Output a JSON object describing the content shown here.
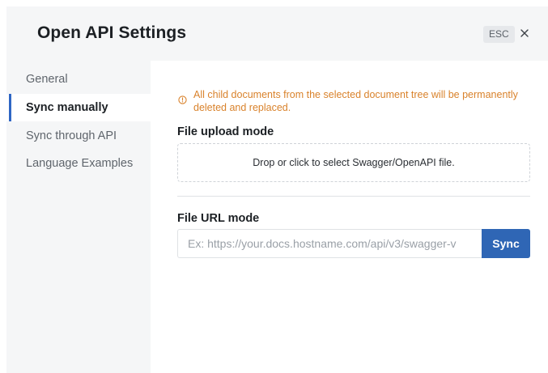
{
  "dialog": {
    "title": "Open API Settings",
    "esc_label": "ESC",
    "close_icon": "close-icon"
  },
  "sidebar": {
    "active_color": "#2f66c4",
    "items": [
      {
        "label": "General",
        "active": false
      },
      {
        "label": "Sync manually",
        "active": true
      },
      {
        "label": "Sync through API",
        "active": false
      },
      {
        "label": "Language Examples",
        "active": false
      }
    ]
  },
  "main": {
    "warning": {
      "icon": "warning-circle-icon",
      "color": "#d9822b",
      "text": "All child documents from the selected document tree will be permanently deleted and replaced."
    },
    "upload_section": {
      "title": "File upload mode",
      "dropzone_text": "Drop or click to select Swagger/OpenAPI file."
    },
    "url_section": {
      "title": "File URL mode",
      "input_value": "",
      "input_placeholder": "Ex: https://your.docs.hostname.com/api/v3/swagger-v",
      "sync_label": "Sync",
      "sync_color": "#2f66b5"
    }
  }
}
